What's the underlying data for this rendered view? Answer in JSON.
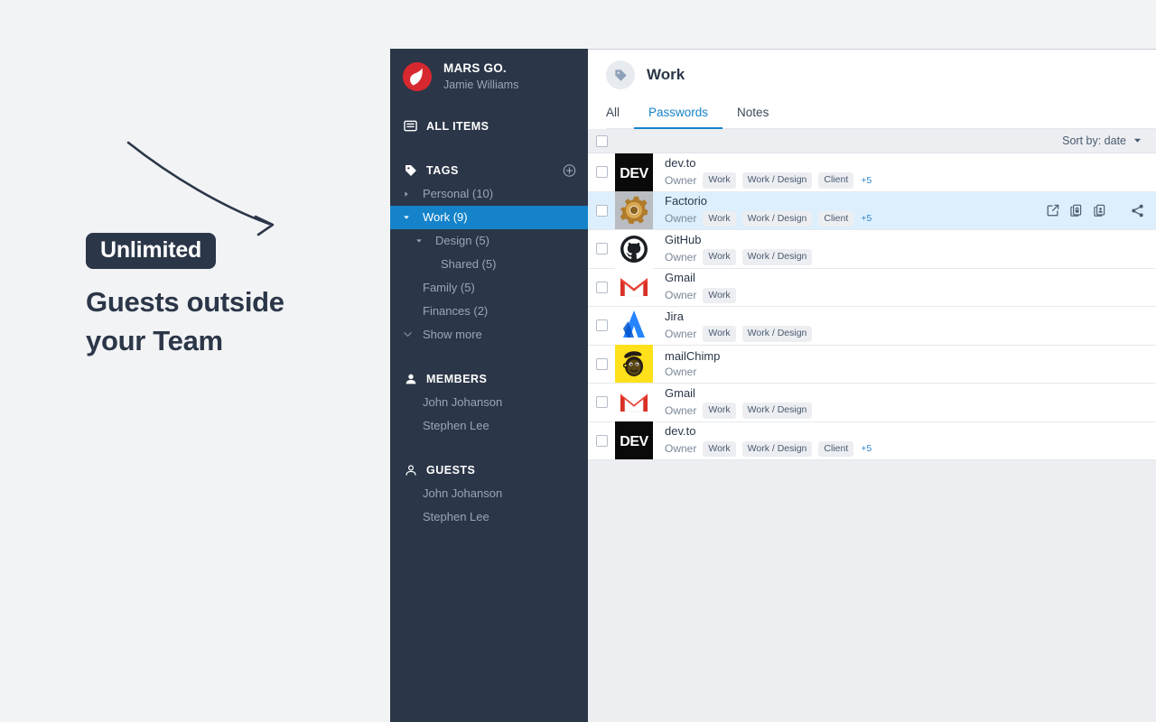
{
  "promo": {
    "badge": "Unlimited",
    "headline": "Guests outside your Team",
    "arrow_icon": "curved-arrow-icon"
  },
  "sidebar": {
    "brand": {
      "logo_icon": "mars-go-logo-icon",
      "title": "MARS GO.",
      "user": "Jamie Williams",
      "brand_color": "#d7282f"
    },
    "all_items": {
      "label": "ALL ITEMS",
      "icon": "inbox-icon"
    },
    "tags_section": {
      "label": "TAGS",
      "icon": "tag-icon",
      "add_icon": "plus-circle-icon"
    },
    "tags": [
      {
        "label": "Personal (10)",
        "level": 0,
        "caret": "collapsed",
        "active": false
      },
      {
        "label": "Work (9)",
        "level": 0,
        "caret": "expanded",
        "active": true
      },
      {
        "label": "Design (5)",
        "level": 1,
        "caret": "expanded",
        "active": false
      },
      {
        "label": "Shared (5)",
        "level": 2,
        "caret": "none",
        "active": false
      },
      {
        "label": "Family (5)",
        "level": 0,
        "caret": "none",
        "active": false
      },
      {
        "label": "Finances (2)",
        "level": 0,
        "caret": "none",
        "active": false
      }
    ],
    "show_more": {
      "label": "Show more",
      "icon": "chevron-down-icon"
    },
    "members_section": {
      "label": "MEMBERS",
      "icon": "person-icon"
    },
    "members": [
      {
        "name": "John Johanson"
      },
      {
        "name": "Stephen Lee"
      }
    ],
    "guests_section": {
      "label": "GUESTS",
      "icon": "person-outline-icon"
    },
    "guests": [
      {
        "name": "John Johanson"
      },
      {
        "name": "Stephen Lee"
      }
    ],
    "bg_color": "#2b3648",
    "active_color": "#1583c9"
  },
  "main": {
    "title": "Work",
    "title_icon": "tag-icon",
    "tabs": [
      {
        "label": "All",
        "active": false
      },
      {
        "label": "Passwords",
        "active": true
      },
      {
        "label": "Notes",
        "active": false
      }
    ],
    "toolbar": {
      "select_all_checkbox": "unchecked",
      "sort_label": "Sort by: date",
      "sort_caret_icon": "caret-down-icon"
    },
    "row_actions": [
      {
        "icon": "external-link-icon",
        "name": "open-item"
      },
      {
        "icon": "copy-password-icon",
        "name": "copy-password"
      },
      {
        "icon": "copy-username-icon",
        "name": "copy-username"
      },
      {
        "icon": "share-icon",
        "name": "share-item"
      }
    ],
    "items": [
      {
        "title": "dev.to",
        "owner": "Owner",
        "icon": "devto-icon",
        "tags": [
          "Work",
          "Work / Design",
          "Client"
        ],
        "more": "+5",
        "selected": false
      },
      {
        "title": "Factorio",
        "owner": "Owner",
        "icon": "factorio-gear-icon",
        "tags": [
          "Work",
          "Work / Design",
          "Client"
        ],
        "more": "+5",
        "selected": true
      },
      {
        "title": "GitHub",
        "owner": "Owner",
        "icon": "github-icon",
        "tags": [
          "Work",
          "Work / Design"
        ],
        "more": "",
        "selected": false
      },
      {
        "title": "Gmail",
        "owner": "Owner",
        "icon": "gmail-icon",
        "tags": [
          "Work"
        ],
        "more": "",
        "selected": false
      },
      {
        "title": "Jira",
        "owner": "Owner",
        "icon": "jira-icon",
        "tags": [
          "Work",
          "Work / Design"
        ],
        "more": "",
        "selected": false
      },
      {
        "title": "mailChimp",
        "owner": "Owner",
        "icon": "mailchimp-icon",
        "tags": [],
        "more": "",
        "selected": false
      },
      {
        "title": "Gmail",
        "owner": "Owner",
        "icon": "gmail-icon",
        "tags": [
          "Work",
          "Work / Design"
        ],
        "more": "",
        "selected": false
      },
      {
        "title": "dev.to",
        "owner": "Owner",
        "icon": "devto-icon",
        "tags": [
          "Work",
          "Work / Design",
          "Client"
        ],
        "more": "+5",
        "selected": false
      }
    ]
  }
}
